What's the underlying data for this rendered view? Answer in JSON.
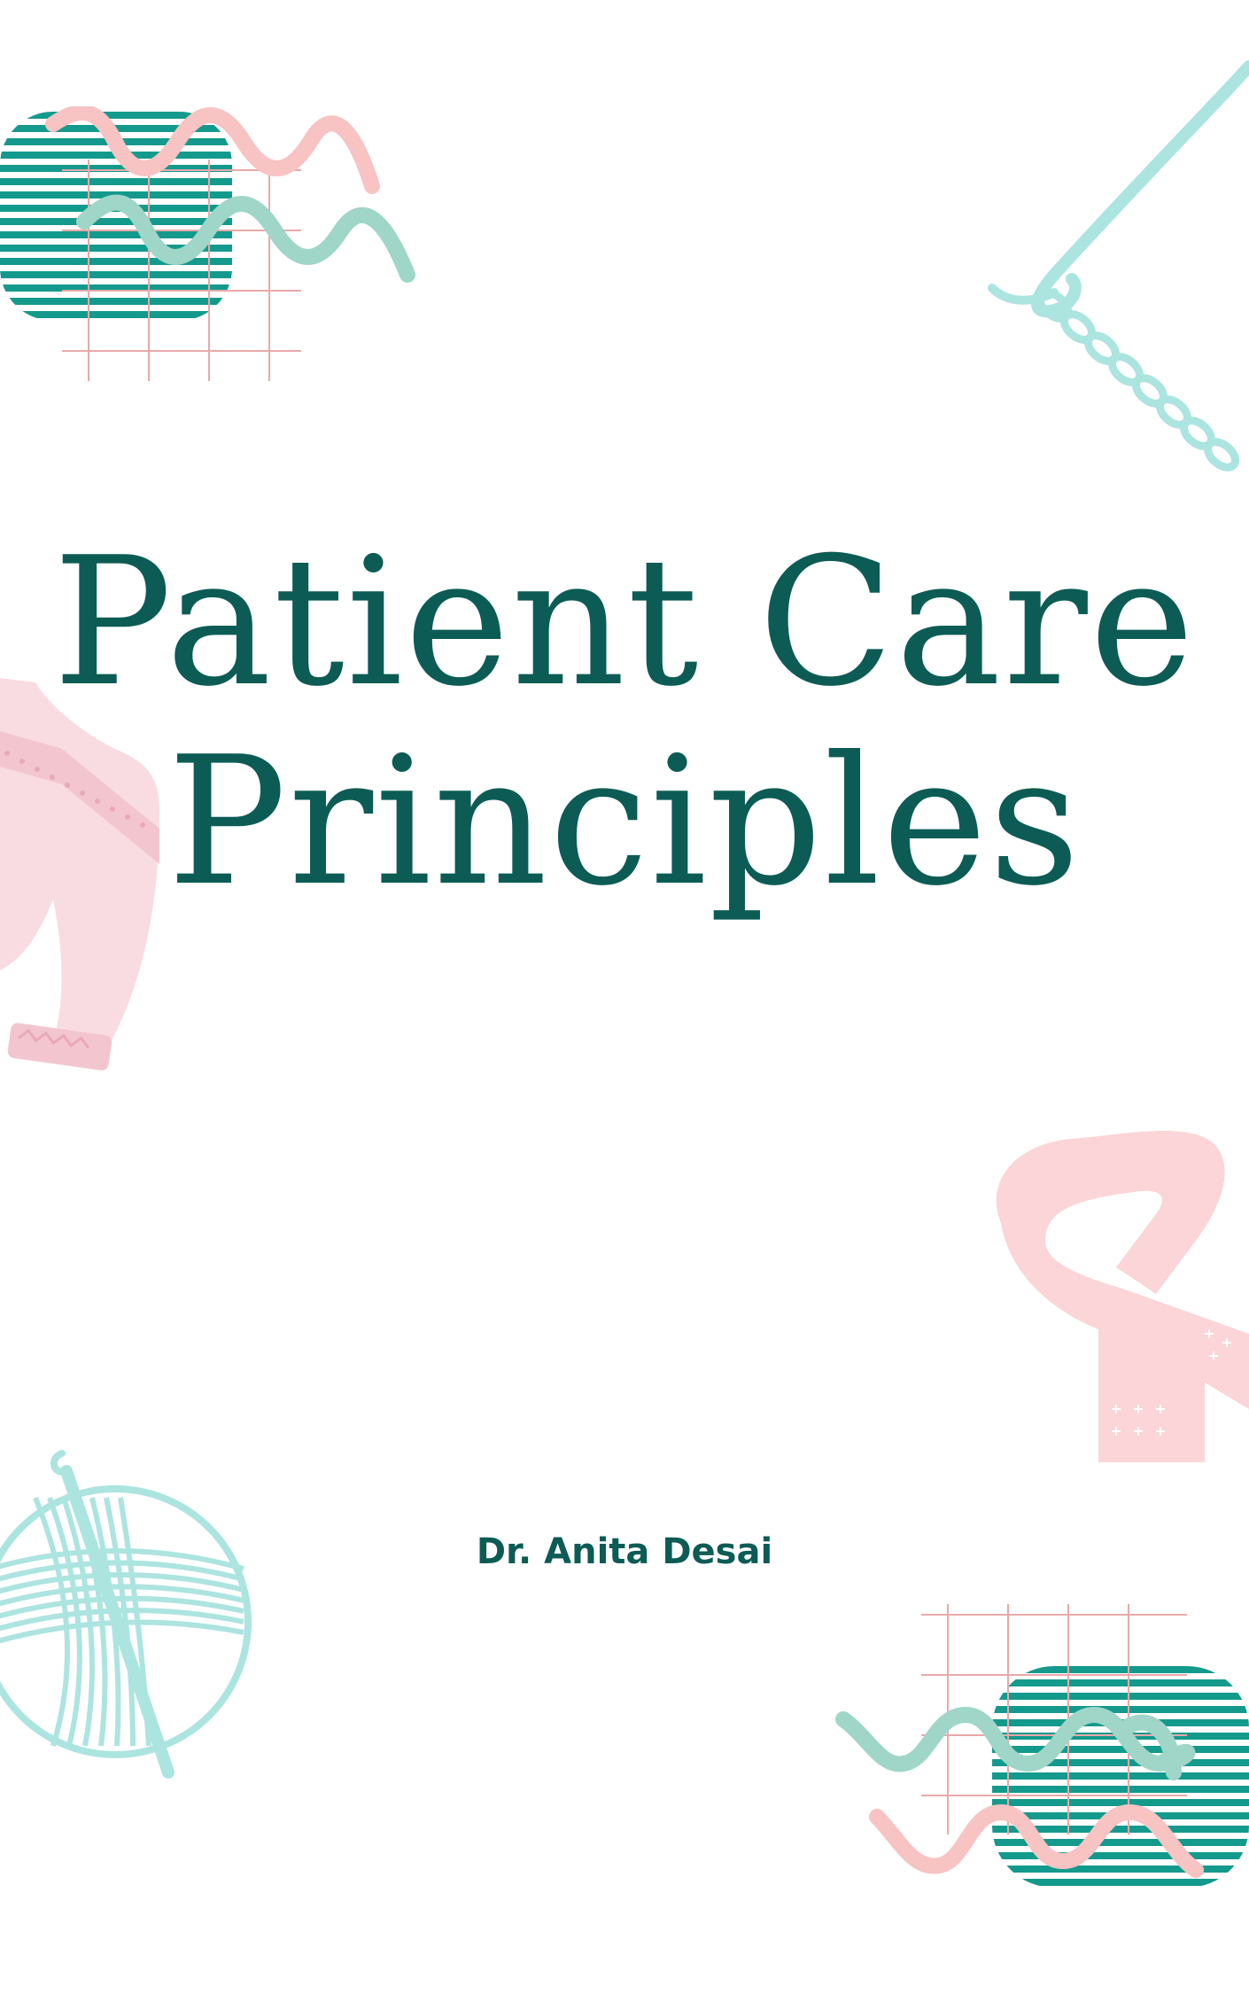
{
  "cover": {
    "title_line1": "Patient Care",
    "title_line2": "Principles",
    "author": "Dr. Anita Desai"
  },
  "colors": {
    "background": "#ffffff",
    "title": "#0c5c55",
    "teal_stripes": "#139a8c",
    "pink_wave": "#f7c3c3",
    "mint_wave": "#9fd6c8",
    "grid_line": "#e8a9a9",
    "aqua": "#ace4e0",
    "pastel_pink": "#fbd5d7",
    "sweater_pink": "#f9dce1"
  },
  "decorations": [
    "striped-grid-wave-ornament",
    "crochet-hook-chain-illustration",
    "sweater-illustration",
    "scarf-illustration",
    "yarn-ball-illustration"
  ]
}
